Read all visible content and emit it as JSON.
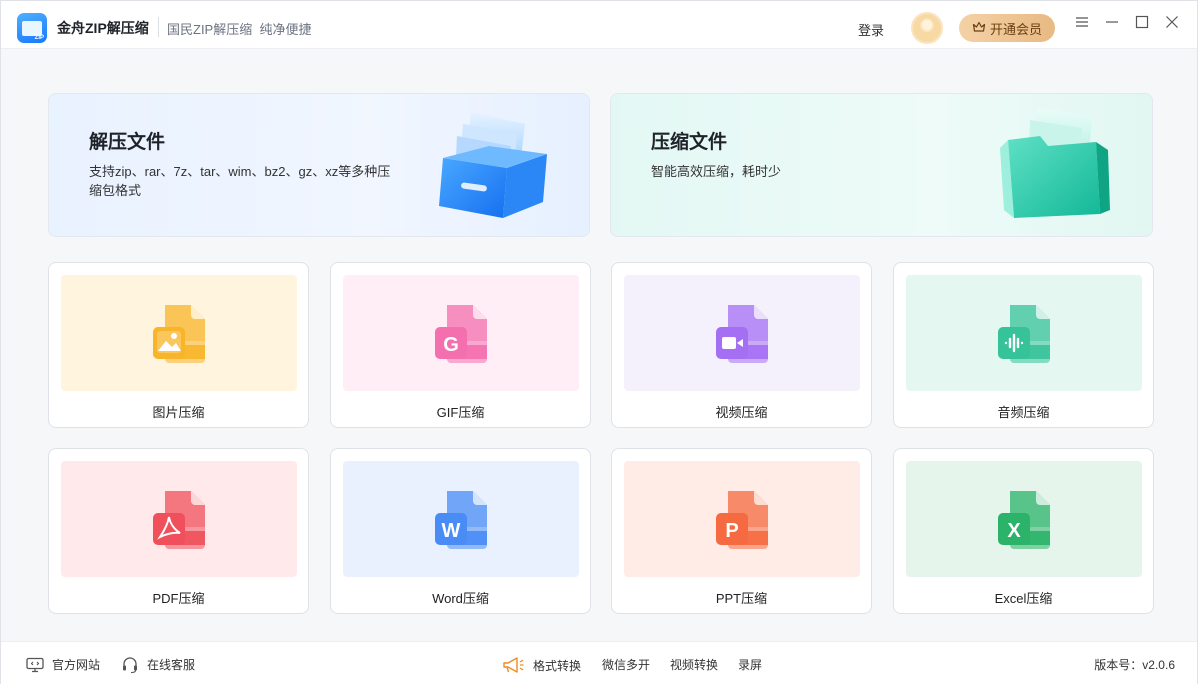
{
  "titlebar": {
    "app_name": "金舟ZIP解压缩",
    "slogan": "国民ZIP解压缩  纯净便捷",
    "login": "登录",
    "vip_label": "开通会员",
    "icons": [
      "menu-icon",
      "minimize-icon",
      "maximize-icon",
      "close-icon"
    ]
  },
  "big_cards": {
    "unzip": {
      "title": "解压文件",
      "desc": "支持zip、rar、7z、tar、wim、bz2、gz、xz等多种压缩包格式"
    },
    "zip": {
      "title": "压缩文件",
      "desc": "智能高效压缩，耗时少"
    }
  },
  "tools": [
    {
      "label": "图片压缩",
      "bg": "#fff4de",
      "color": "#f8b52a",
      "glyph": "image"
    },
    {
      "label": "GIF压缩",
      "bg": "#ffeef6",
      "color": "#f46fae",
      "glyph": "G"
    },
    {
      "label": "视频压缩",
      "bg": "#f4f1fd",
      "color": "#a56ff3",
      "glyph": "video"
    },
    {
      "label": "音频压缩",
      "bg": "#e5f7f1",
      "color": "#37c39a",
      "glyph": "audio"
    },
    {
      "label": "PDF压缩",
      "bg": "#ffe9ea",
      "color": "#f0505b",
      "glyph": "pdf"
    },
    {
      "label": "Word压缩",
      "bg": "#e8f1fd",
      "color": "#4a8cf6",
      "glyph": "W"
    },
    {
      "label": "PPT压缩",
      "bg": "#ffece6",
      "color": "#f56a40",
      "glyph": "P"
    },
    {
      "label": "Excel压缩",
      "bg": "#e5f5ec",
      "color": "#2bb36a",
      "glyph": "X"
    }
  ],
  "footer": {
    "website": "官方网站",
    "support": "在线客服",
    "links": [
      "格式转换",
      "微信多开",
      "视频转换",
      "录屏"
    ],
    "version": "版本号：v2.0.6"
  }
}
